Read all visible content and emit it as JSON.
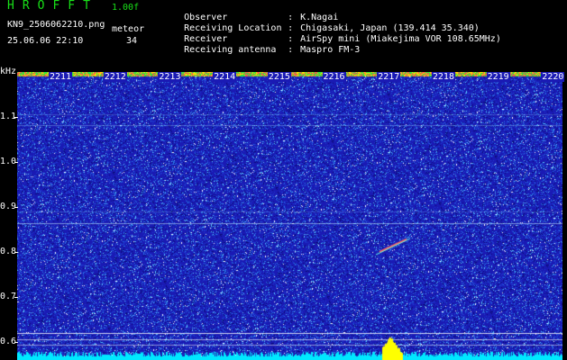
{
  "header": {
    "app_title": "HROFFT",
    "version": "1.00f",
    "filename": "KN9_2506062210.png",
    "timestamp": "25.06.06 22:10",
    "meteor_label": "meteor",
    "meteor_count": "34"
  },
  "station_info": [
    {
      "key": "Observer",
      "value": "K.Nagai"
    },
    {
      "key": "Receiving Location",
      "value": "Chigasaki, Japan (139.414 35.340)"
    },
    {
      "key": "Receiver",
      "value": "AirSpy mini (Miakejima VOR 108.65MHz)"
    },
    {
      "key": "Receiving antenna",
      "value": "Maspro FM-3"
    }
  ],
  "spectrogram": {
    "y_unit": "kHz",
    "y_ticks": [
      "1.1",
      "1.0",
      "0.9",
      "0.8",
      "0.7",
      "0.6"
    ],
    "x_ticks": [
      "2211",
      "2212",
      "2213",
      "2214",
      "2215",
      "2216",
      "2217",
      "2218",
      "2219",
      "2220"
    ],
    "colors": {
      "background": "#1a1ab4",
      "noise_hot": "#ffffff",
      "baseline": "#00e8ff",
      "peak": "#ffff00"
    }
  }
}
